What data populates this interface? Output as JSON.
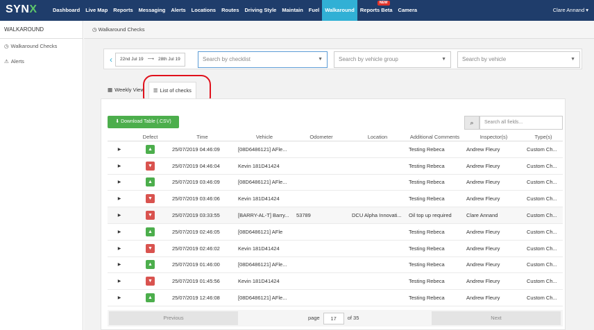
{
  "brand": {
    "logo_main": "SYN",
    "logo_accent": "X"
  },
  "nav": {
    "items": [
      "Dashboard",
      "Live Map",
      "Reports",
      "Messaging",
      "Alerts",
      "Locations",
      "Routes",
      "Driving Style",
      "Maintain",
      "Fuel",
      "Walkaround",
      "Reports Beta",
      "Camera"
    ],
    "active": "Walkaround",
    "new_badge": "NEW",
    "user": "Clare Annand"
  },
  "sidebar": {
    "title": "WALKAROUND",
    "items": [
      "Walkaround Checks",
      "Alerts"
    ]
  },
  "breadcrumb": "Walkaround Checks",
  "filters": {
    "date_from": "22nd Jul 19",
    "date_to": "28th Jul 19",
    "checklist_placeholder": "Search by checklist",
    "group_placeholder": "Search by vehicle group",
    "vehicle_placeholder": "Search by vehicle"
  },
  "tabs": [
    "Weekly View",
    "List of checks"
  ],
  "toolbar": {
    "download_label": "Download Table (.CSV)",
    "search_placeholder": "Search all fields..."
  },
  "table": {
    "headers": [
      "",
      "Defect",
      "Time",
      "Vehicle",
      "Odometer",
      "Location",
      "Additional Comments",
      "Inspector(s)",
      "Type(s)"
    ],
    "rows": [
      {
        "defect": "ok",
        "time": "25/07/2019 04:46:09",
        "vehicle": "[08D6486121] AFle...",
        "odometer": "",
        "location": "",
        "comments": "Testing Rebeca",
        "inspector": "Andrew Fleury",
        "type": "Custom Ch..."
      },
      {
        "defect": "bad",
        "time": "25/07/2019 04:46:04",
        "vehicle": "Kevin 181D41424",
        "odometer": "",
        "location": "",
        "comments": "Testing Rebeca",
        "inspector": "Andrew Fleury",
        "type": "Custom Ch..."
      },
      {
        "defect": "ok",
        "time": "25/07/2019 03:46:09",
        "vehicle": "[08D6486121] AFle...",
        "odometer": "",
        "location": "",
        "comments": "Testing Rebeca",
        "inspector": "Andrew Fleury",
        "type": "Custom Ch..."
      },
      {
        "defect": "bad",
        "time": "25/07/2019 03:46:06",
        "vehicle": "Kevin 181D41424",
        "odometer": "",
        "location": "",
        "comments": "Testing Rebeca",
        "inspector": "Andrew Fleury",
        "type": "Custom Ch..."
      },
      {
        "defect": "bad",
        "time": "25/07/2019 03:33:55",
        "vehicle": "[BARRY-AL-T] Barry...",
        "odometer": "53789",
        "location": "DCU Alpha Innovati...",
        "comments": "Oil top up required",
        "inspector": "Clare Annand",
        "type": "Custom Ch..."
      },
      {
        "defect": "ok",
        "time": "25/07/2019 02:46:05",
        "vehicle": "[08D6486121] AFle",
        "odometer": "",
        "location": "",
        "comments": "Testing Rebeca",
        "inspector": "Andrew Fleury",
        "type": "Custom Ch..."
      },
      {
        "defect": "bad",
        "time": "25/07/2019 02:46:02",
        "vehicle": "Kevin 181D41424",
        "odometer": "",
        "location": "",
        "comments": "Testing Rebeca",
        "inspector": "Andrew Fleury",
        "type": "Custom Ch..."
      },
      {
        "defect": "ok",
        "time": "25/07/2019 01:46:00",
        "vehicle": "[08D6486121] AFle...",
        "odometer": "",
        "location": "",
        "comments": "Testing Rebeca",
        "inspector": "Andrew Fleury",
        "type": "Custom Ch..."
      },
      {
        "defect": "bad",
        "time": "25/07/2019 01:45:56",
        "vehicle": "Kevin 181D41424",
        "odometer": "",
        "location": "",
        "comments": "Testing Rebeca",
        "inspector": "Andrew Fleury",
        "type": "Custom Ch..."
      },
      {
        "defect": "ok",
        "time": "25/07/2019 12:46:08",
        "vehicle": "[08D6486121] AFle...",
        "odometer": "",
        "location": "",
        "comments": "Testing Rebeca",
        "inspector": "Andrew Fleury",
        "type": "Custom Ch..."
      }
    ]
  },
  "pager": {
    "previous": "Previous",
    "next": "Next",
    "page_label": "page",
    "page": "17",
    "of_label": "of 35"
  }
}
